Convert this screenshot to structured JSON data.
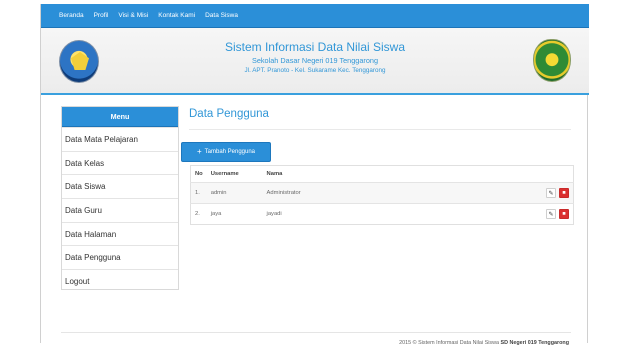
{
  "nav": {
    "items": [
      "Beranda",
      "Profil",
      "Visi & Misi",
      "Kontak Kami",
      "Data Siswa"
    ]
  },
  "header": {
    "title": "Sistem Informasi Data Nilai Siswa",
    "school": "Sekolah Dasar Negeri 019 Tenggarong",
    "address": "Jl. APT. Pranoto - Kel. Sukarame Kec. Tenggarong",
    "left_logo": "tut-wuri-handayani-logo",
    "right_logo": "regency-emblem-logo"
  },
  "sidebar": {
    "heading": "Menu",
    "items": [
      "Data Mata Pelajaran",
      "Data Kelas",
      "Data Siswa",
      "Data Guru",
      "Data Halaman",
      "Data Pengguna",
      "Logout"
    ]
  },
  "main": {
    "title": "Data Pengguna",
    "add_button": "Tambah Pengguna",
    "table": {
      "headers": [
        "No",
        "Username",
        "Nama"
      ],
      "rows": [
        {
          "no": "1.",
          "username": "admin",
          "name": "Administrator"
        },
        {
          "no": "2.",
          "username": "jaya",
          "name": "jayadi"
        }
      ]
    }
  },
  "footer": {
    "prefix": "2015 © Sistem Informasi Data Nilai Siswa",
    "school": "SD Negeri 019 Tenggarong"
  },
  "colors": {
    "primary": "#2b8fd8",
    "title_blue": "#3297d7",
    "delete_red": "#da3030"
  },
  "icons": {
    "add": "plus-icon",
    "edit": "pencil-icon",
    "delete": "trash-icon"
  }
}
